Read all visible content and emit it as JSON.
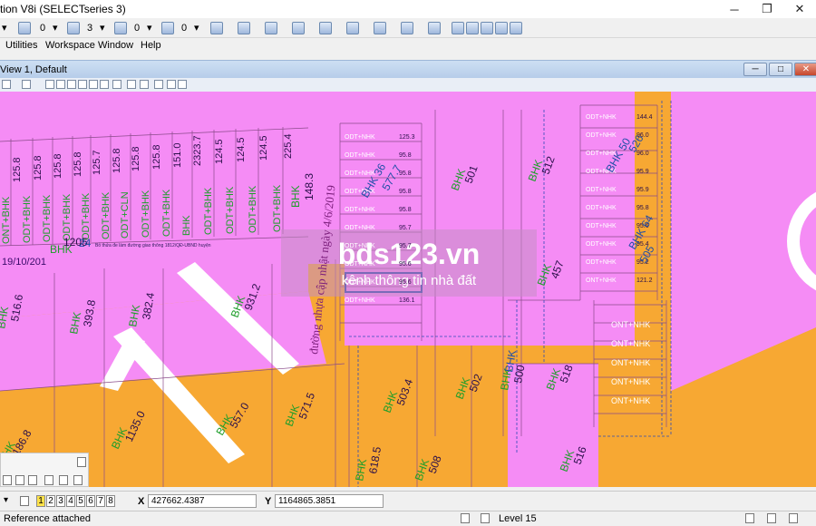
{
  "window": {
    "title": "tion V8i (SELECTseries 3)",
    "minimize_glyph": "─",
    "maximize_glyph": "❐",
    "close_glyph": "✕"
  },
  "toolbar": {
    "dropdown_arrow": "▾",
    "color_value": "0",
    "style_value": "0",
    "weight_value": "3",
    "transparency_value": "0",
    "priority_value": "0"
  },
  "menu": {
    "utilities": "Utilities",
    "workspace": "Workspace",
    "window": "Window",
    "help": "Help"
  },
  "view": {
    "title": "View 1, Default",
    "minimize_glyph": "─",
    "maximize_glyph": "□",
    "close_glyph": "✕"
  },
  "map": {
    "watermark_title": "bds123.vn",
    "watermark_subtitle": "kênh thông tin nhà đất",
    "road_label": "đường nhựa cập nhật ngày 4/6/2019",
    "date_label": "19/10/201",
    "road_note": "Bỏ thửa đe làm đường giao thông 1812/QĐ-UBND huyện",
    "left_strip_labels": [
      "ONT+BHK",
      "ODT+BHK",
      "ODT+BHK",
      "ODT+BHK",
      "ODT+BHK",
      "ODT+BHK",
      "ODT+CLN",
      "ODT+BHK",
      "ODT+BHK",
      "BHK",
      "ODT+BHK",
      "ODT+BHK",
      "ODT+BHK",
      "ODT+BHK"
    ],
    "left_strip_values": [
      "125.8",
      "125.8",
      "125.8",
      "125.8",
      "125.7",
      "125.8",
      "125.8",
      "125.8",
      "151.0",
      "2323.7",
      "124.5",
      "124.5",
      "124.5",
      "225.4"
    ],
    "large_parcels": [
      {
        "code": "BHK",
        "value": "148.3"
      },
      {
        "code": "BHK",
        "value": "1205",
        "num": "24"
      },
      {
        "code": "BHK",
        "value": "516.6"
      },
      {
        "code": "BHK",
        "value": "393.8"
      },
      {
        "code": "BHK",
        "value": "382.4"
      },
      {
        "code": "BHK",
        "value": "931.2"
      },
      {
        "code": "BHK",
        "value": "1135.0"
      },
      {
        "code": "BHK",
        "value": "557.0"
      },
      {
        "code": "BHK",
        "value": "571.5"
      },
      {
        "code": "BHK",
        "value": "503.4"
      },
      {
        "code": "BHK",
        "value": "502"
      },
      {
        "code": "BHK",
        "value": "518"
      },
      {
        "code": "BHK",
        "value": "516"
      },
      {
        "code": "BHK",
        "value": "508"
      },
      {
        "code": "BHK",
        "value": "501"
      },
      {
        "code": "BHK",
        "value": "512"
      },
      {
        "code": "BHK",
        "value": "457"
      },
      {
        "code": "BHK",
        "value": "500"
      },
      {
        "code": "BHK",
        "value": "186.8"
      },
      {
        "code": "BHK",
        "value": "618.5"
      }
    ],
    "mid_column_labels": [
      "ODT+NHK",
      "ODT+NHK",
      "ODT+NHK",
      "ODT+NHK",
      "ODT+NHK",
      "ODT+NHK",
      "ODT+NHK",
      "ODT+NHK",
      "ODT+NHK",
      "ODT+NHK"
    ],
    "mid_column_values": [
      "125.3",
      "95.8",
      "95.8",
      "95.8",
      "95.8",
      "95.7",
      "95.7",
      "95.6",
      "95.6",
      "136.1"
    ],
    "right_column_labels": [
      "ODT+NHK",
      "ODT+NHK",
      "ODT+NHK",
      "ODT+NHK",
      "ODT+NHK",
      "ODT+NHK",
      "ODT+NHK",
      "ODT+NHK",
      "ODT+NHK",
      "ONT+NHK",
      "ONT+NHK",
      "ONT+NHK",
      "ONT+NHK",
      "ONT+NHK",
      "ONT+NHK"
    ],
    "right_column_values": [
      "144.4",
      "96.0",
      "96.0",
      "95.9",
      "95.9",
      "95.8",
      "95.6",
      "95.4",
      "95.2",
      "121.2"
    ],
    "blue_labels": [
      "BHK 36",
      "BHK 50",
      "BHK 64",
      "BHK",
      "577.7",
      "526",
      "505"
    ]
  },
  "bottom": {
    "view_numbers": [
      "1",
      "2",
      "3",
      "4",
      "5",
      "6",
      "7",
      "8"
    ],
    "active_view": "1",
    "x_label": "X",
    "x_value": "427662.4387",
    "y_label": "Y",
    "y_value": "1164865.3851"
  },
  "status": {
    "message": "Reference attached",
    "level": "Level 15"
  },
  "colors": {
    "pink": "#f58cf5",
    "orange": "#f7a833",
    "accent_blue": "#1f4fa8"
  }
}
